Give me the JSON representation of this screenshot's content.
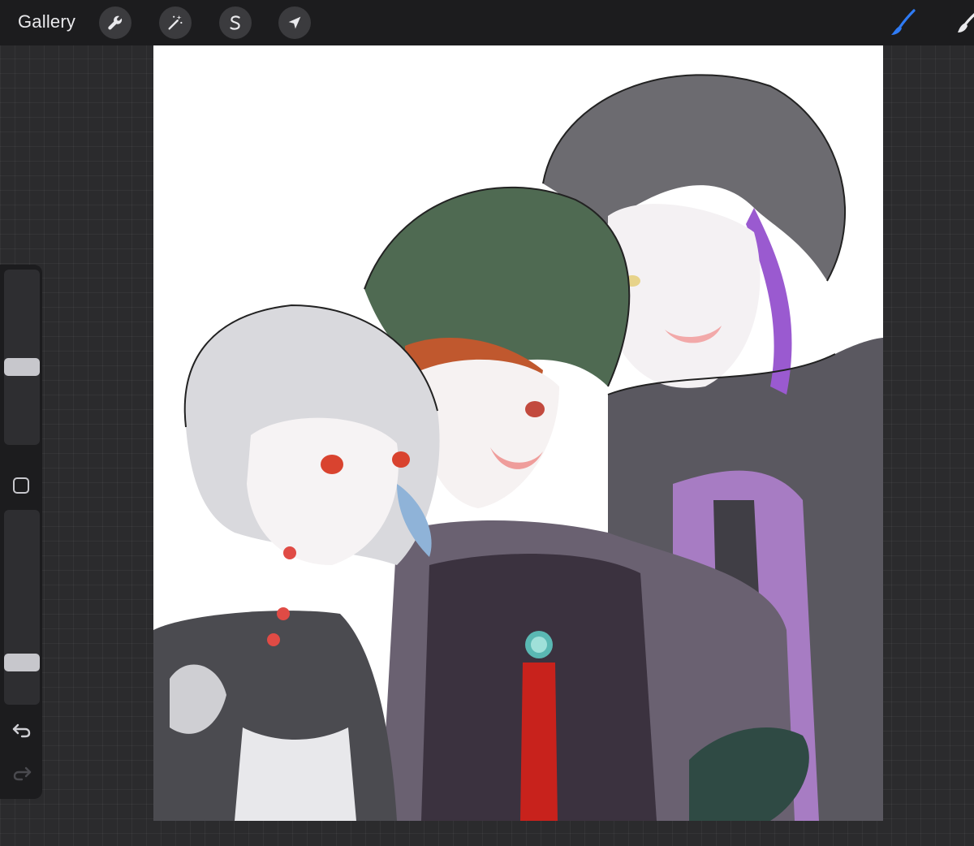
{
  "toolbar": {
    "gallery_label": "Gallery",
    "tools": [
      {
        "icon": "wrench-icon",
        "name": "actions"
      },
      {
        "icon": "magic-wand-icon",
        "name": "adjustments"
      },
      {
        "icon": "selection-s-icon",
        "name": "selection"
      },
      {
        "icon": "arrow-cursor-icon",
        "name": "transform"
      }
    ],
    "active_tool": "brush-icon",
    "accent_color": "#2f7bf5"
  },
  "sidebar": {
    "brush_size_level": 0.44,
    "opacity_level": 0.19
  },
  "canvas": {
    "background": "#ffffff",
    "content": "artwork"
  }
}
